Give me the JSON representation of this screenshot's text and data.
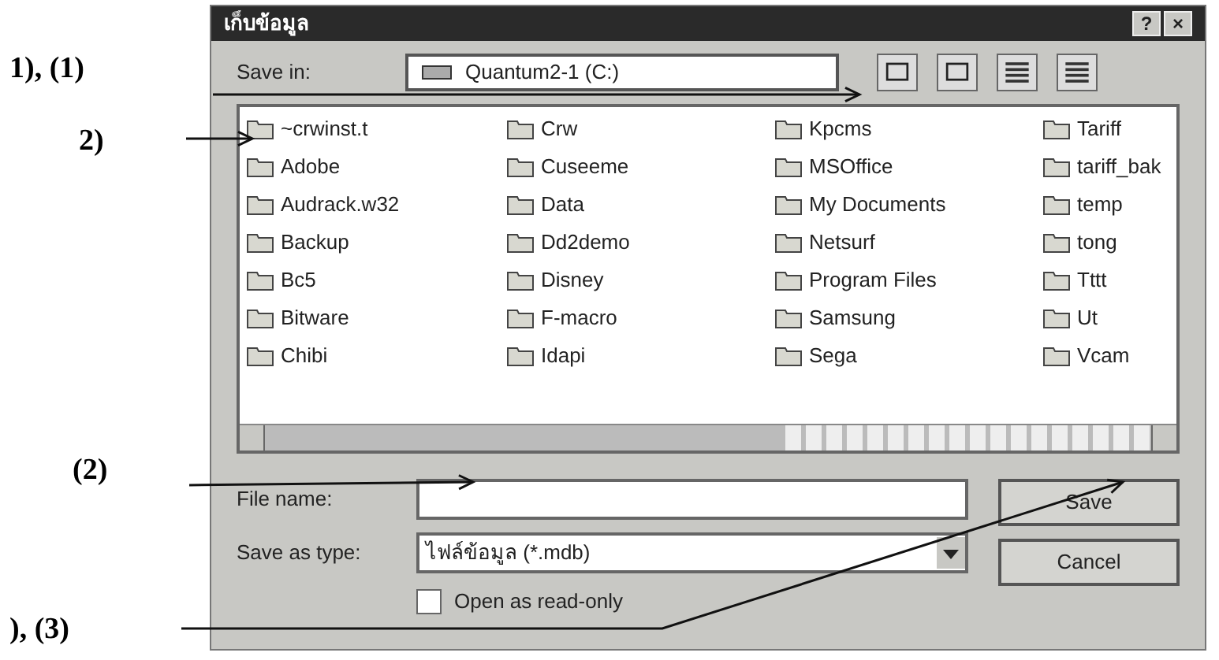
{
  "annotations": [
    {
      "label": "1), (1)"
    },
    {
      "label": "2)"
    },
    {
      "label": "(2)"
    },
    {
      "label": "), (3)"
    }
  ],
  "window": {
    "title": "เก็บข้อมูล",
    "buttons": [
      "?",
      "×"
    ]
  },
  "save_in": {
    "label": "Save in:",
    "value": "Quantum2-1 (C:)"
  },
  "files": [
    [
      "~crwinst.t",
      "Adobe",
      "Audrack.w32",
      "Backup",
      "Bc5",
      "Bitware",
      "Chibi"
    ],
    [
      "Crw",
      "Cuseeme",
      "Data",
      "Dd2demo",
      "Disney",
      "F-macro",
      "Idapi"
    ],
    [
      "Kpcms",
      "MSOffice",
      "My Documents",
      "Netsurf",
      "Program Files",
      "Samsung",
      "Sega"
    ],
    [
      "Tariff",
      "tariff_bak",
      "temp",
      "tong",
      "Tttt",
      "Ut",
      "Vcam"
    ]
  ],
  "file_name": {
    "label": "File name:"
  },
  "save_as_type": {
    "label": "Save as type:",
    "value": "ไฟล์ข้อมูล (*.mdb)"
  },
  "read_only": {
    "label": "Open as read-only",
    "checked": false
  },
  "buttons": [
    "Save",
    "Cancel"
  ]
}
